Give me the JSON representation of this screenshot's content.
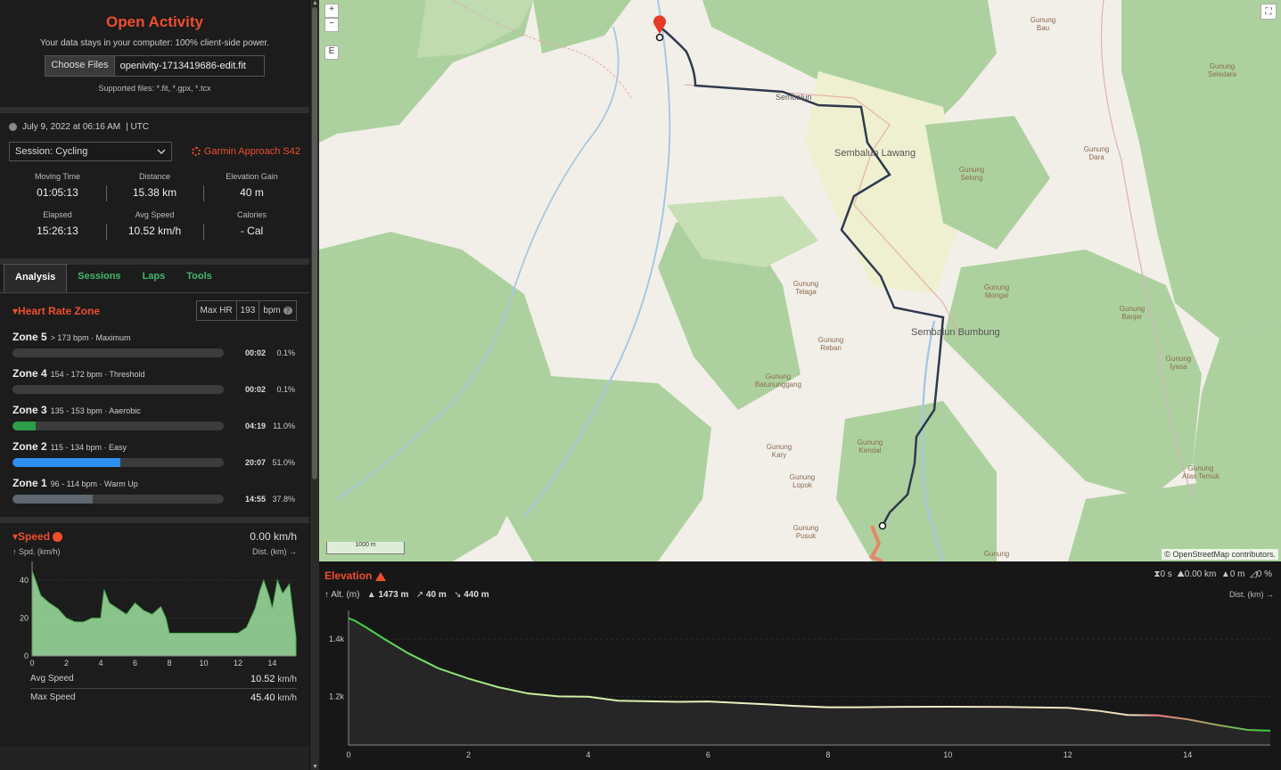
{
  "app": {
    "title": "Open Activity",
    "tagline": "Your data stays in your computer: 100% client-side power.",
    "choose_files": "Choose Files",
    "file_name": "openivity-1713419686-edit.fit",
    "supported": "Supported files: *.fit, *.gpx, *.tcx"
  },
  "overview": {
    "date": "July 9, 2022 at 06:16 AM",
    "tz": "| UTC",
    "session_select": "Session: Cycling",
    "device": "Garmin Approach S42",
    "stats": [
      {
        "label": "Moving Time",
        "value": "01:05:13"
      },
      {
        "label": "Distance",
        "value": "15.38 km"
      },
      {
        "label": "Elevation Gain",
        "value": "40 m"
      },
      {
        "label": "Elapsed",
        "value": "15:26:13"
      },
      {
        "label": "Avg Speed",
        "value": "10.52 km/h"
      },
      {
        "label": "Calories",
        "value": "- Cal"
      }
    ]
  },
  "tabs": [
    "Analysis",
    "Sessions",
    "Laps",
    "Tools"
  ],
  "heart_rate": {
    "title": "Heart Rate Zone",
    "max_label": "Max HR",
    "max_value": "193",
    "unit": "bpm",
    "zones": [
      {
        "name": "Zone 5",
        "desc": "> 173 bpm · Maximum",
        "time": "00:02",
        "pct": "0.1%",
        "frac": 0.001,
        "color": "#3c3c3c"
      },
      {
        "name": "Zone 4",
        "desc": "154 - 172 bpm · Threshold",
        "time": "00:02",
        "pct": "0.1%",
        "frac": 0.001,
        "color": "#3c3c3c"
      },
      {
        "name": "Zone 3",
        "desc": "135 - 153 bpm · Aaerobic",
        "time": "04:19",
        "pct": "11.0%",
        "frac": 0.11,
        "color": "#2e9e4a"
      },
      {
        "name": "Zone 2",
        "desc": "115 - 134 bpm · Easy",
        "time": "20:07",
        "pct": "51.0%",
        "frac": 0.51,
        "color": "#2e8ff0"
      },
      {
        "name": "Zone 1",
        "desc": "96 - 114 bpm · Warm Up",
        "time": "14:55",
        "pct": "37.8%",
        "frac": 0.378,
        "color": "#5f6870"
      }
    ]
  },
  "speed": {
    "title": "Speed",
    "current": "0.00 km/h",
    "y_label": "↑ Spd. (km/h)",
    "x_label": "Dist. (km) →",
    "avg_label": "Avg Speed",
    "avg_value": "10.52",
    "max_label": "Max Speed",
    "max_value": "45.40",
    "unit": "km/h"
  },
  "map": {
    "zoom_in": "+",
    "zoom_out": "−",
    "layers": "E",
    "scale": "1000 m",
    "attribution": "© OpenStreetMap contributors.",
    "towns": [
      "Sembalun Lawang",
      "Sembalun Bumbung",
      "Sembalun"
    ],
    "peaks": [
      "Gunung Bau",
      "Gunung Seledara",
      "Gunung Dara",
      "Gunung Selong",
      "Gunung Telaga",
      "Gunung Mongal",
      "Gunung Banjer",
      "Gunung Reban",
      "Gunung Batununggang",
      "Gunung Iyasa",
      "Gunung Kary",
      "Gunung Kendal",
      "Gunung Lopok",
      "Gunung Pusuk",
      "Gunung Atas Temuk",
      "Gunung"
    ]
  },
  "elevation": {
    "title": "Elevation",
    "y_label": "↑ Alt. (m)",
    "max_alt": "1473 m",
    "gain": "40 m",
    "loss": "440 m",
    "x_label": "Dist. (km) →",
    "stats": [
      "0 s",
      "0.00 km",
      "0 m",
      "0 %"
    ]
  },
  "chart_data": [
    {
      "type": "area",
      "title": "Speed",
      "xlabel": "Dist. (km)",
      "ylabel": "Spd. (km/h)",
      "xlim": [
        0,
        15.38
      ],
      "ylim": [
        0,
        50
      ],
      "x_ticks": [
        0,
        2,
        4,
        6,
        8,
        10,
        12,
        14
      ],
      "y_ticks": [
        0,
        20,
        40
      ],
      "series": [
        {
          "name": "Speed",
          "x": [
            0,
            0.2,
            0.5,
            1,
            1.5,
            2,
            2.5,
            3,
            3.5,
            4,
            4.2,
            4.5,
            5,
            5.5,
            6,
            6.5,
            7,
            7.5,
            7.8,
            8,
            9,
            10,
            11,
            12,
            12.5,
            13,
            13.3,
            13.5,
            13.8,
            14,
            14.3,
            14.6,
            15,
            15.38
          ],
          "y": [
            45,
            40,
            32,
            28,
            25,
            20,
            18,
            18,
            20,
            20,
            35,
            28,
            25,
            22,
            28,
            24,
            22,
            26,
            20,
            12,
            12,
            12,
            12,
            12,
            15,
            25,
            35,
            40,
            32,
            25,
            40,
            33,
            38,
            10
          ]
        }
      ]
    },
    {
      "type": "line",
      "title": "Elevation",
      "xlabel": "Dist. (km)",
      "ylabel": "Alt. (m)",
      "xlim": [
        0,
        15.38
      ],
      "ylim": [
        1030,
        1500
      ],
      "x_ticks": [
        0,
        2,
        4,
        6,
        8,
        10,
        12,
        14
      ],
      "y_ticks": [
        1200,
        1400
      ],
      "series": [
        {
          "name": "Altitude",
          "x": [
            0,
            0.1,
            0.3,
            0.6,
            1,
            1.5,
            2,
            2.5,
            3,
            3.5,
            4,
            4.5,
            5,
            5.5,
            6,
            6.5,
            7,
            7.5,
            8,
            8.5,
            9,
            10,
            11,
            12,
            12.5,
            13,
            13.5,
            14,
            14.5,
            15,
            15.38
          ],
          "y": [
            1473,
            1465,
            1440,
            1400,
            1350,
            1298,
            1262,
            1232,
            1210,
            1200,
            1199,
            1185,
            1183,
            1181,
            1182,
            1177,
            1172,
            1166,
            1162,
            1162,
            1163,
            1164,
            1163,
            1160,
            1150,
            1135,
            1134,
            1120,
            1100,
            1083,
            1080
          ]
        }
      ]
    }
  ]
}
